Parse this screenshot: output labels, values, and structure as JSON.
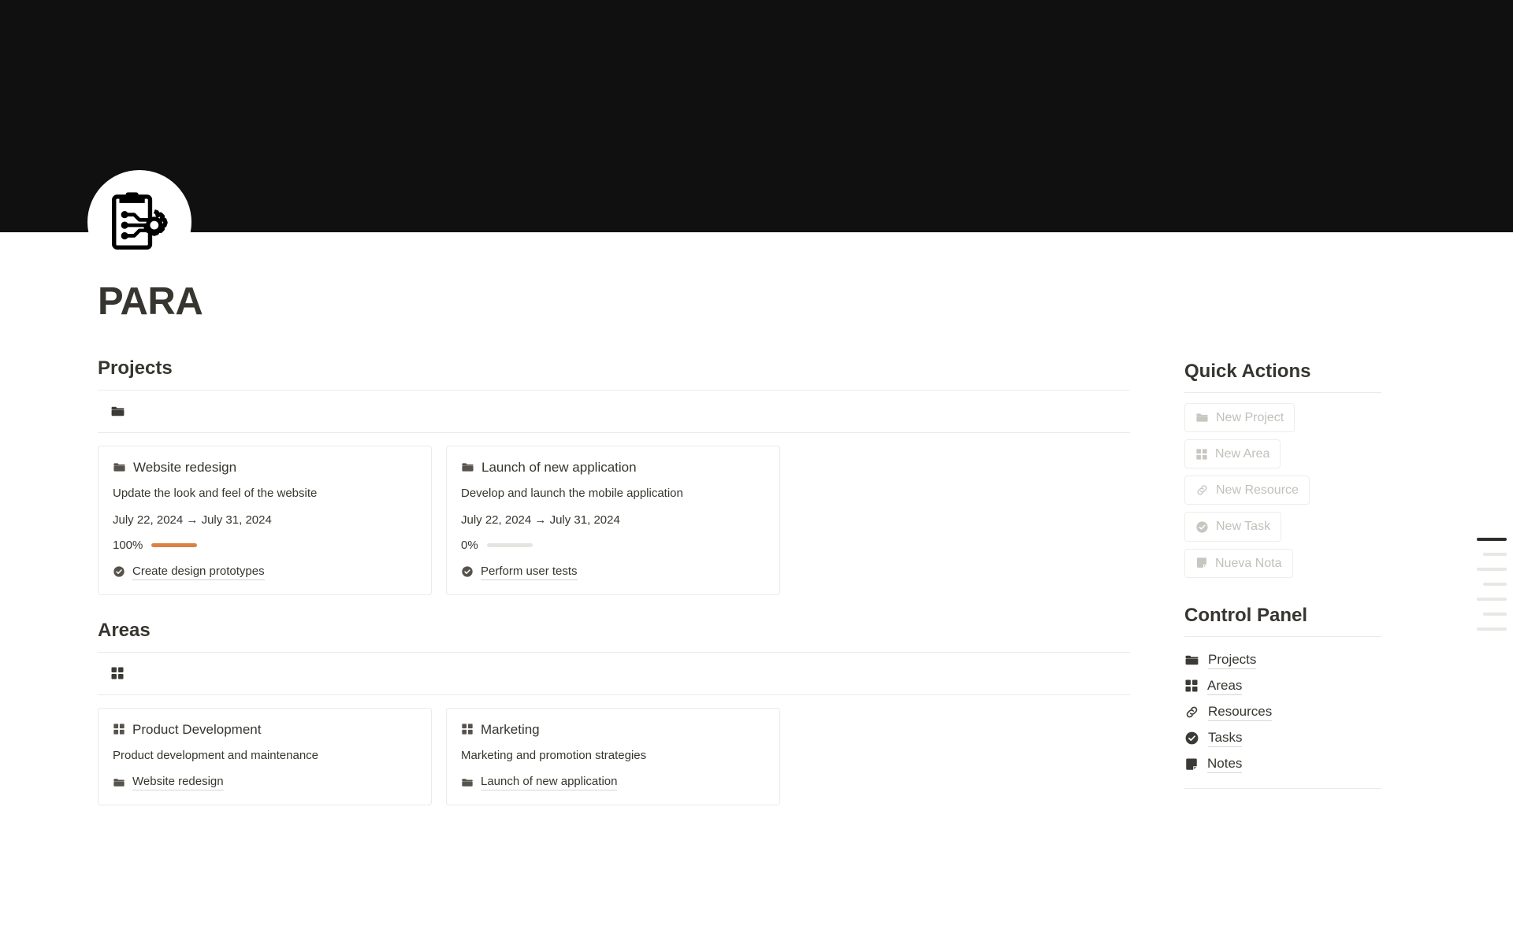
{
  "page": {
    "title": "PARA",
    "avatar_icon": "clipboard-gear-icon",
    "banner_colors": {
      "orange": "#f5761a",
      "tan": "#c49e80",
      "dark": "#141313"
    }
  },
  "sections": [
    {
      "id": "projects",
      "heading": "Projects",
      "db_icon": "folder-icon",
      "cards": [
        {
          "icon": "folder-icon",
          "title": "Website redesign",
          "description": "Update the look and feel of the website",
          "date_start": "July 22, 2024",
          "date_arrow": "→",
          "date_end": "July 31, 2024",
          "progress_label": "100%",
          "progress_value": 100,
          "progress_color": "#d98243",
          "relation_icon": "check-circle-icon",
          "relation_label": "Create design prototypes"
        },
        {
          "icon": "folder-icon",
          "title": "Launch of new application",
          "description": "Develop and launch the mobile application",
          "date_start": "July 22, 2024",
          "date_arrow": "→",
          "date_end": "July 31, 2024",
          "progress_label": "0%",
          "progress_value": 0,
          "progress_color": "#d98243",
          "relation_icon": "check-circle-icon",
          "relation_label": "Perform user tests"
        }
      ]
    },
    {
      "id": "areas",
      "heading": "Areas",
      "db_icon": "grid-icon",
      "cards": [
        {
          "icon": "grid-icon",
          "title": "Product Development",
          "description": "Product development and maintenance",
          "relation_icon": "folder-icon",
          "relation_label": "Website redesign"
        },
        {
          "icon": "grid-icon",
          "title": "Marketing",
          "description": "Marketing and promotion strategies",
          "relation_icon": "folder-icon",
          "relation_label": "Launch of new application"
        }
      ]
    }
  ],
  "sidebar": {
    "quick_actions": {
      "heading": "Quick Actions",
      "buttons": [
        {
          "icon": "folder-icon",
          "label": "New Project"
        },
        {
          "icon": "grid-icon",
          "label": "New Area"
        },
        {
          "icon": "link-icon",
          "label": "New Resource"
        },
        {
          "icon": "check-circle-icon",
          "label": "New Task"
        },
        {
          "icon": "note-icon",
          "label": "Nueva Nota"
        }
      ]
    },
    "control_panel": {
      "heading": "Control Panel",
      "links": [
        {
          "icon": "folder-icon",
          "label": "Projects"
        },
        {
          "icon": "grid-icon",
          "label": "Areas"
        },
        {
          "icon": "link-icon",
          "label": "Resources"
        },
        {
          "icon": "check-circle-icon",
          "label": "Tasks"
        },
        {
          "icon": "note-icon",
          "label": "Notes"
        }
      ]
    }
  },
  "toc": {
    "items": [
      {
        "active": true,
        "width": "w1"
      },
      {
        "active": false,
        "width": "w2"
      },
      {
        "active": false,
        "width": "w1"
      },
      {
        "active": false,
        "width": "w2"
      },
      {
        "active": false,
        "width": "w1"
      },
      {
        "active": false,
        "width": "w2"
      },
      {
        "active": false,
        "width": "w1"
      }
    ]
  }
}
